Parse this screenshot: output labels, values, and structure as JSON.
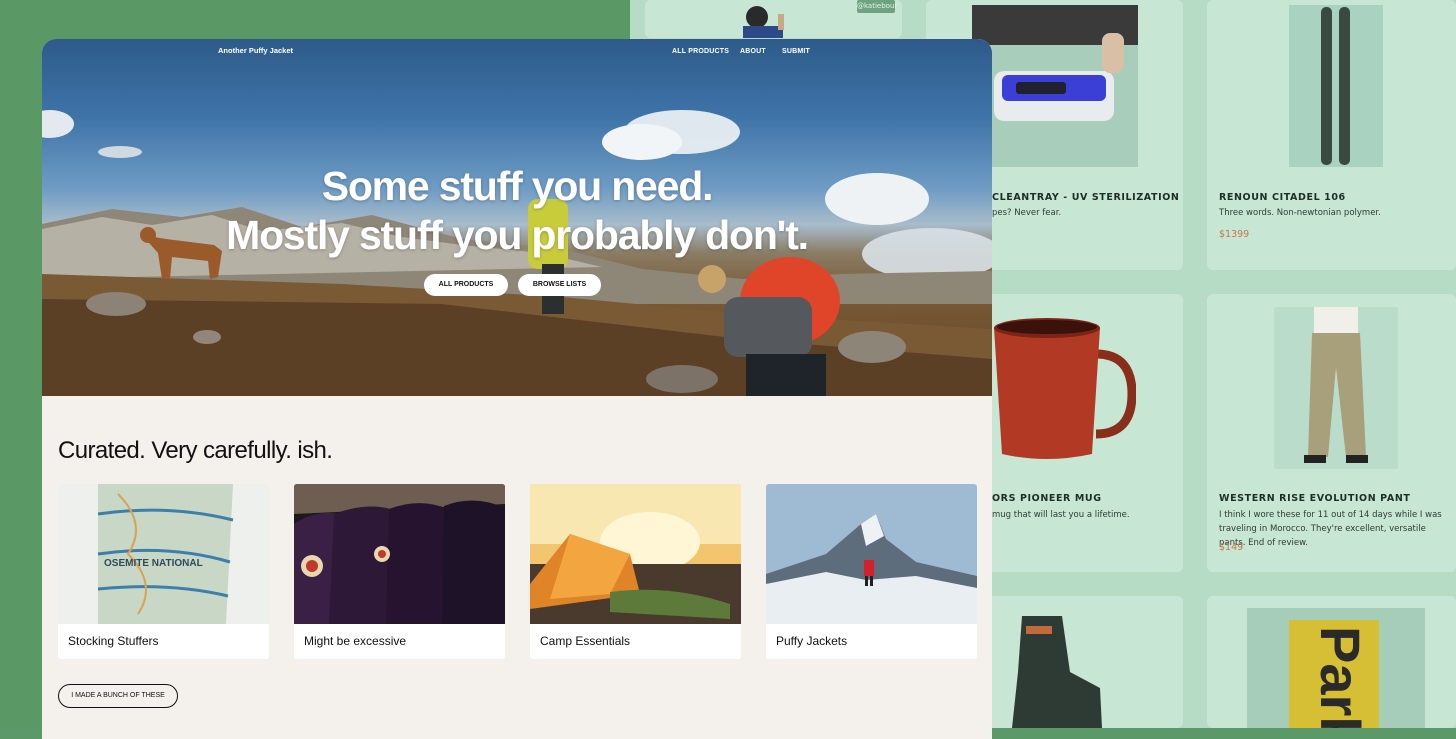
{
  "site": {
    "brand": "Another Puffy Jacket"
  },
  "nav": {
    "items": [
      "ALL PRODUCTS",
      "ABOUT",
      "SUBMIT"
    ]
  },
  "hero": {
    "headline_1": "Some stuff you need.",
    "headline_2": "Mostly stuff you probably don't.",
    "buttons": [
      "ALL PRODUCTS",
      "BROWSE LISTS"
    ]
  },
  "curated": {
    "title": "Curated. Very carefully. ish.",
    "lists": [
      "Stocking Stuffers",
      "Might be excessive",
      "Camp Essentials",
      "Puffy Jackets"
    ],
    "more_button": "I MADE A BUNCH OF THESE"
  },
  "background_products": {
    "handle": "@katiebour",
    "items": [
      {
        "name": "CLEANTRAY - UV STERILIZATION POD",
        "desc": "pes? Never fear.",
        "price": ""
      },
      {
        "name": "RENOUN CITADEL 106",
        "desc": "Three words. Non-newtonian polymer.",
        "price": "$1399"
      },
      {
        "name": "ORS PIONEER MUG",
        "desc": "mug that will last you a lifetime.",
        "price": ""
      },
      {
        "name": "WESTERN RISE EVOLUTION PANT",
        "desc": "I think I wore these for 11 out of 14 days while I was traveling in Morocco. They're excellent, versatile pants. End of review.",
        "price": "$149"
      }
    ],
    "book_text": "Park"
  },
  "colors": {
    "left_bg": "#5a9966",
    "right_bg": "#b7dcc6",
    "card_bg": "#c8e6d4",
    "price": "#c7764a",
    "page_bg": "#f4f0eb"
  },
  "icons": [
    "uv-pod-image",
    "ski-image",
    "mug-image",
    "pants-image",
    "ski-boot-image",
    "book-image"
  ]
}
